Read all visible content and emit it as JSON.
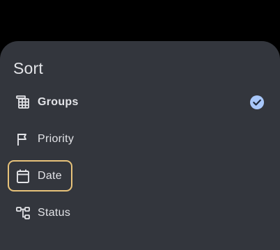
{
  "sheet": {
    "title": "Sort",
    "options": [
      {
        "label": "Groups",
        "icon": "groups-icon",
        "selected": true
      },
      {
        "label": "Priority",
        "icon": "flag-icon",
        "selected": false
      },
      {
        "label": "Date",
        "icon": "calendar-icon",
        "selected": false,
        "focused": true
      },
      {
        "label": "Status",
        "icon": "status-tree-icon",
        "selected": false
      }
    ]
  },
  "colors": {
    "background": "#000000",
    "sheet": "#33363d",
    "text": "#e3e4e8",
    "check": "#a8c7fa",
    "focus_ring": "#e8c37a"
  }
}
